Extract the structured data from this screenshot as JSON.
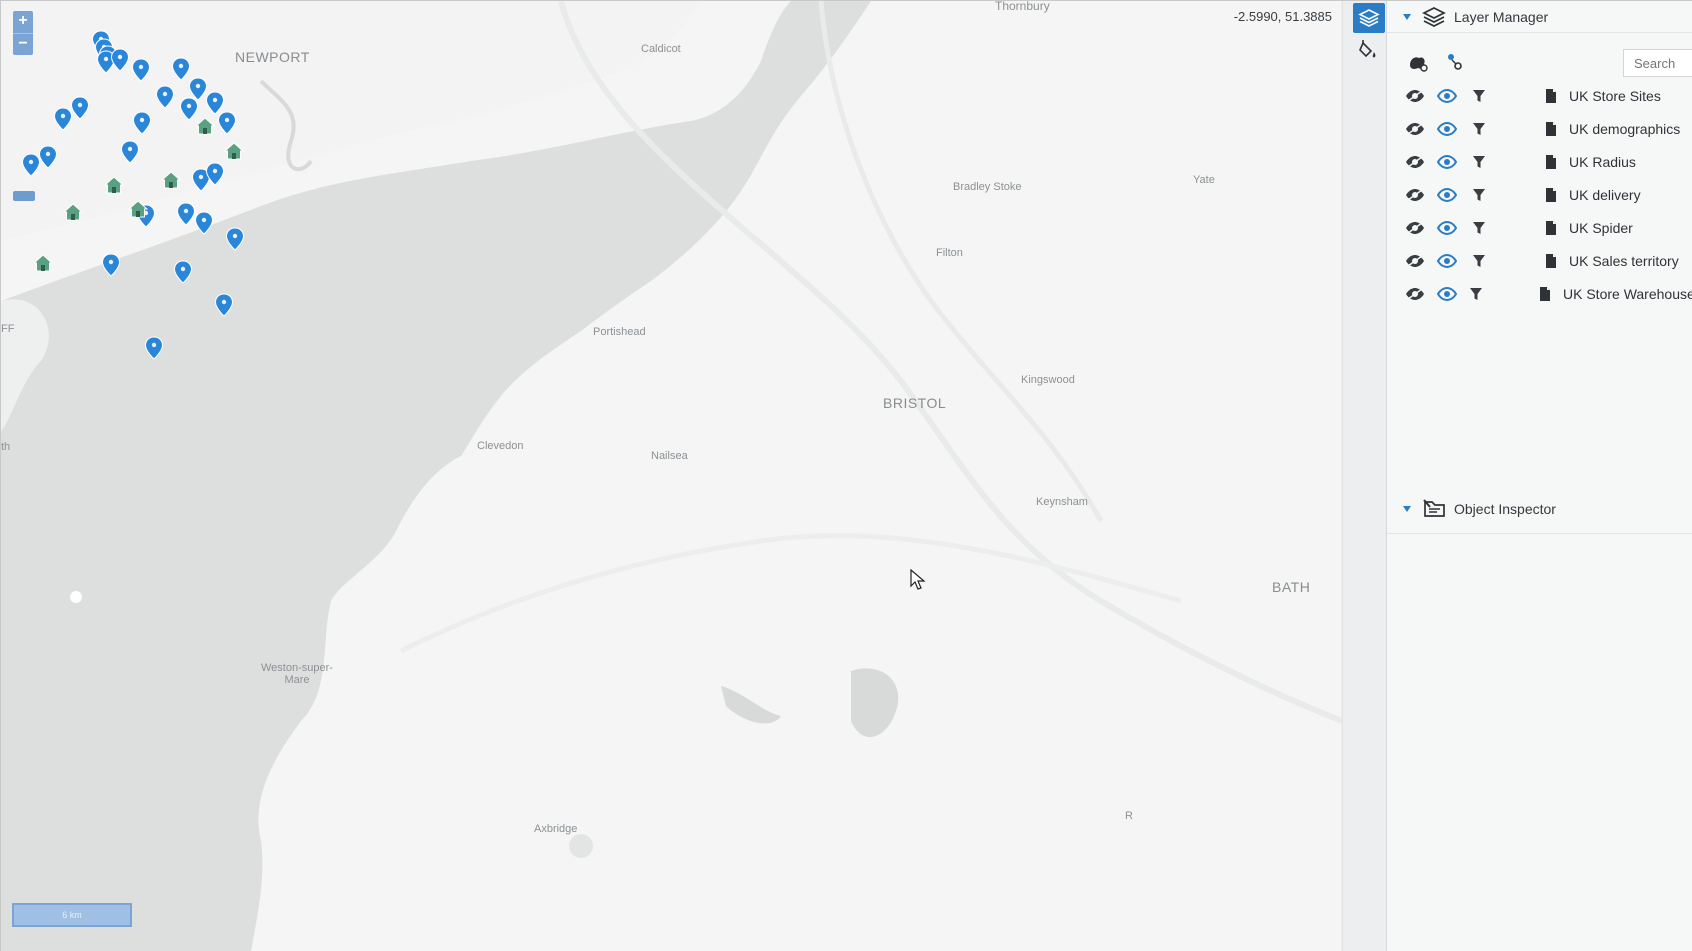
{
  "map": {
    "coordinates": "-2.5990, 51.3885",
    "scale_label": "6 km",
    "zoom_in": "+",
    "zoom_out": "−",
    "places": [
      {
        "name": "Thornbury",
        "cls": "mid"
      },
      {
        "name": "NEWPORT",
        "cls": "big"
      },
      {
        "name": "Caldicot",
        "cls": ""
      },
      {
        "name": "Bradley Stoke",
        "cls": ""
      },
      {
        "name": "Yate",
        "cls": ""
      },
      {
        "name": "Filton",
        "cls": ""
      },
      {
        "name": "Portishead",
        "cls": ""
      },
      {
        "name": "BRISTOL",
        "cls": "big"
      },
      {
        "name": "Kingswood",
        "cls": ""
      },
      {
        "name": "Clevedon",
        "cls": ""
      },
      {
        "name": "Nailsea",
        "cls": ""
      },
      {
        "name": "Keynsham",
        "cls": ""
      },
      {
        "name": "BATH",
        "cls": "big"
      },
      {
        "name": "Weston-super-\nMare",
        "cls": ""
      },
      {
        "name": "Axbridge",
        "cls": ""
      },
      {
        "name": "FF",
        "cls": ""
      },
      {
        "name": "th",
        "cls": ""
      },
      {
        "name": "R",
        "cls": ""
      }
    ],
    "store_sites": [
      {
        "lng": -2.788,
        "lat": 51.491
      },
      {
        "lng": -2.785,
        "lat": 51.486
      },
      {
        "lng": -2.781,
        "lat": 51.482
      },
      {
        "lng": -2.783,
        "lat": 51.479
      },
      {
        "lng": -2.77,
        "lat": 51.48
      },
      {
        "lng": -2.751,
        "lat": 51.474
      },
      {
        "lng": -2.715,
        "lat": 51.475
      },
      {
        "lng": -2.822,
        "lat": 51.445
      },
      {
        "lng": -2.807,
        "lat": 51.452
      },
      {
        "lng": -2.75,
        "lat": 51.443
      },
      {
        "lng": -2.729,
        "lat": 51.458
      },
      {
        "lng": -2.707,
        "lat": 51.451
      },
      {
        "lng": -2.699,
        "lat": 51.463
      },
      {
        "lng": -2.684,
        "lat": 51.455
      },
      {
        "lng": -2.673,
        "lat": 51.443
      },
      {
        "lng": -2.852,
        "lat": 51.418
      },
      {
        "lng": -2.836,
        "lat": 51.423
      },
      {
        "lng": -2.761,
        "lat": 51.426
      },
      {
        "lng": -2.696,
        "lat": 51.409
      },
      {
        "lng": -2.684,
        "lat": 51.413
      },
      {
        "lng": -2.747,
        "lat": 51.388
      },
      {
        "lng": -2.71,
        "lat": 51.389
      },
      {
        "lng": -2.694,
        "lat": 51.384
      },
      {
        "lng": -2.665,
        "lat": 51.374
      },
      {
        "lng": -2.779,
        "lat": 51.359
      },
      {
        "lng": -2.713,
        "lat": 51.355
      },
      {
        "lng": -2.675,
        "lat": 51.335
      },
      {
        "lng": -2.739,
        "lat": 51.31
      }
    ],
    "warehouses": [
      {
        "lng": -2.693,
        "lat": 51.447
      },
      {
        "lng": -2.666,
        "lat": 51.432
      },
      {
        "lng": -2.776,
        "lat": 51.412
      },
      {
        "lng": -2.724,
        "lat": 51.415
      },
      {
        "lng": -2.813,
        "lat": 51.396
      },
      {
        "lng": -2.754,
        "lat": 51.398
      },
      {
        "lng": -2.841,
        "lat": 51.366
      }
    ]
  },
  "layer_manager": {
    "title": "Layer Manager",
    "search_placeholder": "Search",
    "layers": [
      {
        "name": "UK Store Sites"
      },
      {
        "name": "UK demographics"
      },
      {
        "name": "UK Radius"
      },
      {
        "name": "UK delivery"
      },
      {
        "name": "UK Spider"
      },
      {
        "name": "UK Sales territory"
      },
      {
        "name": "UK Store Warehouse"
      }
    ]
  },
  "object_inspector": {
    "title": "Object Inspector"
  },
  "colors": {
    "accent": "#2a7dc4",
    "pin": "#2a86d8",
    "warehouse": "#5aa183",
    "water": "#dcdede",
    "land": "#f4f5f4"
  },
  "icons": {
    "layers": "layers-icon",
    "bucket": "paint-bucket-icon",
    "visibility": "eye-icon",
    "filter": "filter-icon",
    "document": "document-icon"
  }
}
